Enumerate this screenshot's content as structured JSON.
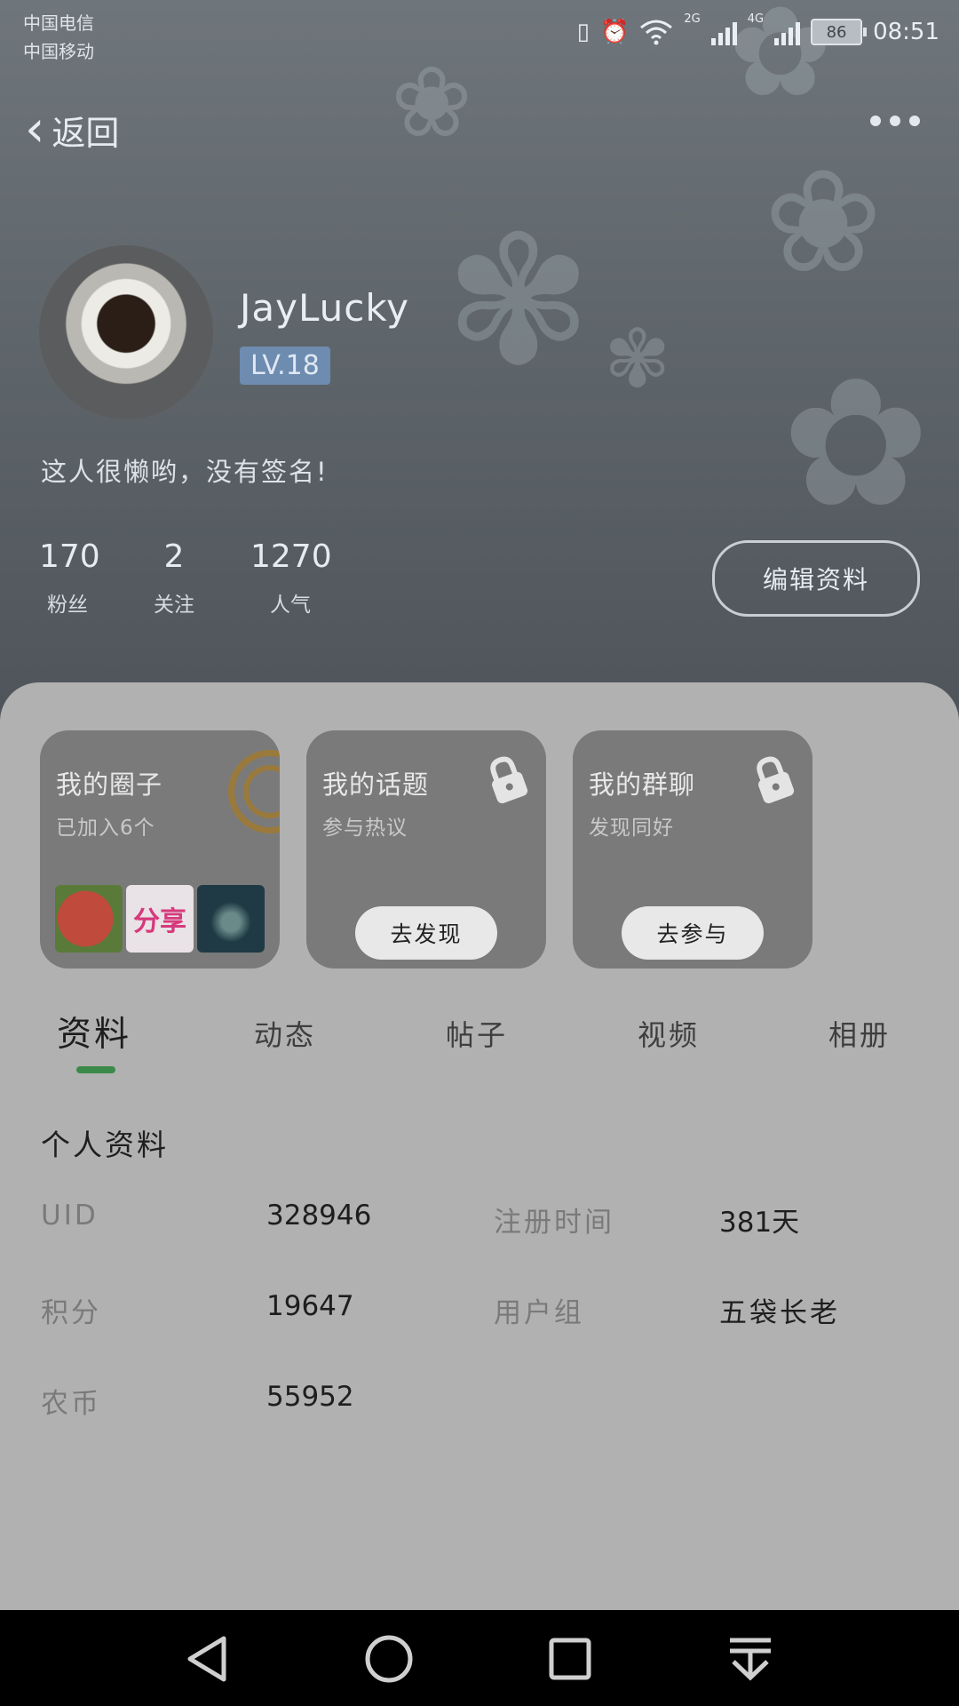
{
  "status_bar": {
    "carrier_1": "中国电信",
    "carrier_2": "中国移动",
    "net_1": "2G",
    "net_2": "4G",
    "battery": "86",
    "time": "08:51"
  },
  "header": {
    "back_label": "返回"
  },
  "profile": {
    "username": "JayLucky",
    "level": "LV.18",
    "signature": "这人很懒哟，没有签名!",
    "stats": [
      {
        "value": "170",
        "label": "粉丝"
      },
      {
        "value": "2",
        "label": "关注"
      },
      {
        "value": "1270",
        "label": "人气"
      }
    ],
    "edit_button": "编辑资料"
  },
  "cards": [
    {
      "title": "我的圈子",
      "subtitle": "已加入6个",
      "thumb_share_text": "分享"
    },
    {
      "title": "我的话题",
      "subtitle": "参与热议",
      "button": "去发现"
    },
    {
      "title": "我的群聊",
      "subtitle": "发现同好",
      "button": "去参与"
    }
  ],
  "tabs": [
    {
      "label": "资料",
      "active": true
    },
    {
      "label": "动态",
      "active": false
    },
    {
      "label": "帖子",
      "active": false
    },
    {
      "label": "视频",
      "active": false
    },
    {
      "label": "相册",
      "active": false
    }
  ],
  "profile_info": {
    "section_title": "个人资料",
    "rows": [
      {
        "label1": "UID",
        "value1": "328946",
        "label2": "注册时间",
        "value2": "381天"
      },
      {
        "label1": "积分",
        "value1": "19647",
        "label2": "用户组",
        "value2": "五袋长老"
      },
      {
        "label1": "农币",
        "value1": "55952"
      }
    ]
  },
  "colors": {
    "accent_tab_underline": "#3c8a4a",
    "level_badge": "#6e8bb0",
    "panel": "#b1b1b1",
    "card": "#7a7a7a"
  }
}
